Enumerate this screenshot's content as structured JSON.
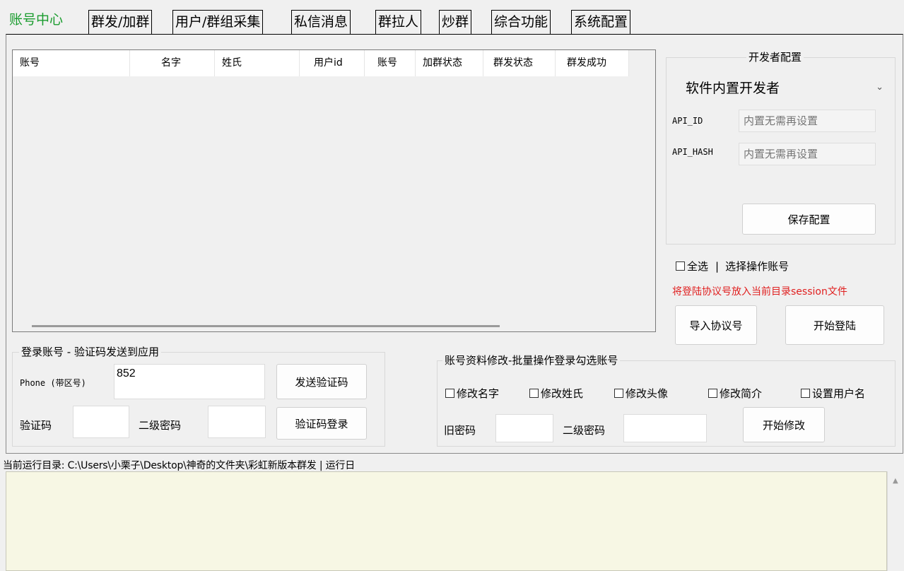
{
  "tabs": [
    "账号中心",
    "群发/加群",
    "用户/群组采集",
    "私信消息",
    "群拉人",
    "炒群",
    "综合功能",
    "系统配置"
  ],
  "accounts_table": {
    "columns": [
      "账号",
      "名字",
      "姓氏",
      "用户id",
      "账号",
      "加群状态",
      "群发状态",
      "群发成功"
    ],
    "rows": []
  },
  "dev_config": {
    "title": "开发者配置",
    "select_value": "软件内置开发者",
    "api_id_label": "API_ID",
    "api_id_placeholder": "内置无需再设置",
    "api_hash_label": "API_HASH",
    "api_hash_placeholder": "内置无需再设置",
    "save_button": "保存配置"
  },
  "select_all": {
    "label": "全选",
    "separator": "|",
    "hint": "选择操作账号"
  },
  "session_notice": "将登陆协议号放入当前目录session文件",
  "session_notice_color": "#e02020",
  "import_button": "导入协议号",
  "start_login_button": "开始登陆",
  "login_group": {
    "title": "登录账号 - 验证码发送到应用",
    "phone_label": "Phone (带区号)",
    "phone_value": "852",
    "send_code_button": "发送验证码",
    "code_label": "验证码",
    "twofa_label": "二级密码",
    "code_login_button": "验证码登录"
  },
  "profile_group": {
    "title": "账号资料修改-批量操作登录勾选账号",
    "checkboxes": [
      "修改名字",
      "修改姓氏",
      "修改头像",
      "修改简介",
      "设置用户名"
    ],
    "old_password_label": "旧密码",
    "twofa_label": "二级密码",
    "start_button": "开始修改"
  },
  "status_bar": "当前运行目录: C:\\Users\\小栗子\\Desktop\\神奇的文件夹\\彩虹新版本群发 |  运行日",
  "active_tab_color": "#1a9c2e",
  "log_background": "#f7f7e4"
}
